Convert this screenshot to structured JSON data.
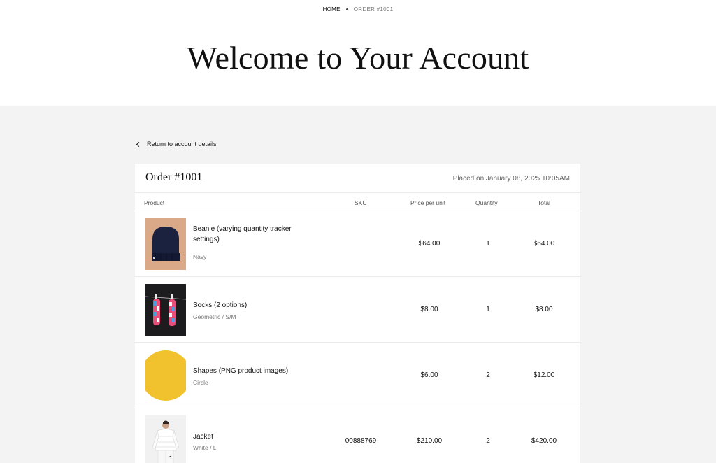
{
  "breadcrumb": {
    "home": "HOME",
    "current": "ORDER #1001"
  },
  "page": {
    "title": "Welcome to Your Account"
  },
  "back_link": "Return to account details",
  "order": {
    "title": "Order #1001",
    "placed": "Placed on January 08, 2025 10:05AM"
  },
  "columns": {
    "product": "Product",
    "sku": "SKU",
    "price": "Price per unit",
    "quantity": "Quantity",
    "total": "Total"
  },
  "items": [
    {
      "name": "Beanie (varying quantity tracker settings)",
      "variant": "Navy",
      "sku": "",
      "price": "$64.00",
      "quantity": "1",
      "total": "$64.00"
    },
    {
      "name": "Socks (2 options)",
      "variant": "Geometric / S/M",
      "sku": "",
      "price": "$8.00",
      "quantity": "1",
      "total": "$8.00"
    },
    {
      "name": "Shapes (PNG product images)",
      "variant": "Circle",
      "sku": "",
      "price": "$6.00",
      "quantity": "2",
      "total": "$12.00"
    },
    {
      "name": "Jacket",
      "variant": "White / L",
      "sku": "00888769",
      "price": "$210.00",
      "quantity": "2",
      "total": "$420.00"
    }
  ],
  "colors": {
    "band": "#f3f3f3",
    "divider": "#ebebeb",
    "text": "#111111",
    "muted": "#777777"
  }
}
